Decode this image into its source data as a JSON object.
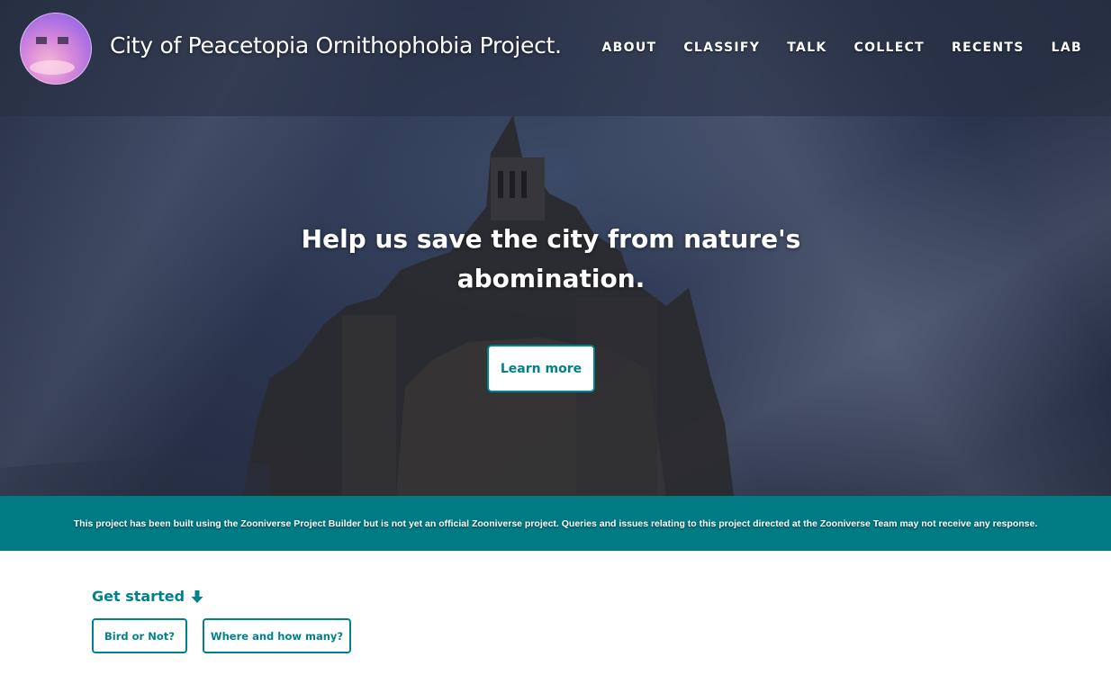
{
  "header": {
    "project_title": "City of Peacetopia Ornithophobia Project.",
    "avatar_icon": "project-avatar",
    "nav": [
      {
        "label": "ABOUT"
      },
      {
        "label": "CLASSIFY"
      },
      {
        "label": "TALK"
      },
      {
        "label": "COLLECT"
      },
      {
        "label": "RECENTS"
      },
      {
        "label": "LAB"
      }
    ]
  },
  "hero": {
    "headline": "Help us save the city from nature's abomination.",
    "learn_more_label": "Learn more",
    "background_image": "castle-on-island"
  },
  "banner": {
    "text": "This project has been built using the Zooniverse Project Builder but is not yet an official Zooniverse project. Queries and issues relating to this project directed at the Zooniverse Team may not receive any response."
  },
  "get_started": {
    "label": "Get started",
    "icon": "arrow-down-icon",
    "workflows": [
      {
        "label": "Bird or Not?"
      },
      {
        "label": "Where and how many?"
      }
    ]
  },
  "colors": {
    "accent": "#00828c",
    "banner": "#007a83"
  }
}
